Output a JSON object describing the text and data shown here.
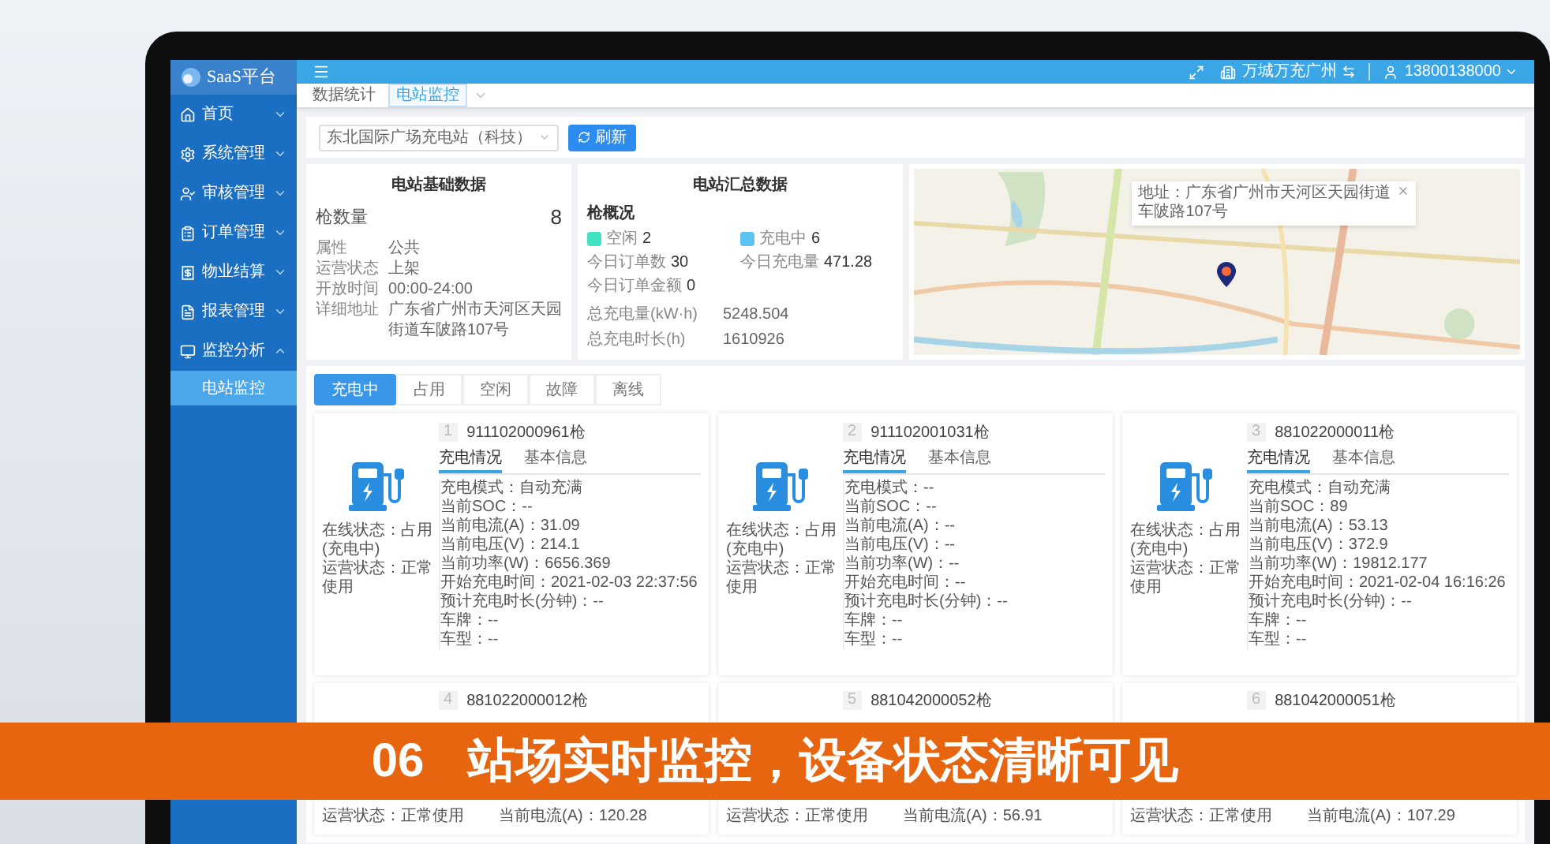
{
  "sidebar": {
    "logo": "SaaS平台",
    "items": [
      {
        "label": "首页",
        "expanded": false
      },
      {
        "label": "系统管理",
        "expanded": false
      },
      {
        "label": "审核管理",
        "expanded": false
      },
      {
        "label": "订单管理",
        "expanded": false
      },
      {
        "label": "物业结算",
        "expanded": false
      },
      {
        "label": "报表管理",
        "expanded": false
      },
      {
        "label": "监控分析",
        "expanded": true,
        "children": [
          {
            "label": "电站监控",
            "selected": true
          }
        ]
      }
    ]
  },
  "header": {
    "account": "万城万充广州",
    "user": "13800138000"
  },
  "breadcrumb": [
    {
      "label": "数据统计",
      "selected": false
    },
    {
      "label": "电站监控",
      "selected": true
    }
  ],
  "filter": {
    "station": "东北国际广场充电站（科技）",
    "button": "刷新"
  },
  "station_basic": {
    "title": "电站基础数据",
    "count_label": "枪数量",
    "count": "8",
    "rows": [
      {
        "label": "属性",
        "value": "公共"
      },
      {
        "label": "运营状态",
        "value": "上架"
      },
      {
        "label": "开放时间",
        "value": "00:00-24:00"
      },
      {
        "label": "详细地址",
        "value": "广东省广州市天河区天园街道车陂路107号"
      }
    ]
  },
  "station_summary": {
    "title": "电站汇总数据",
    "section": "枪概况",
    "statuses": [
      {
        "label": "空闲",
        "count": "2",
        "color": "#3fe3c3"
      },
      {
        "label": "充电中",
        "count": "6",
        "color": "#5cc3f2"
      }
    ],
    "today": [
      {
        "label": "今日订单数",
        "value": "30"
      },
      {
        "label": "今日充电量",
        "value": "471.28"
      },
      {
        "label": "今日订单金额",
        "value": "0"
      }
    ],
    "totals": [
      {
        "label": "总充电量(kW·h)",
        "value": "5248.504"
      },
      {
        "label": "总充电时长(h)",
        "value": "1610926"
      }
    ]
  },
  "map": {
    "popup": "地址：广东省广州市天河区天园街道车陂路107号"
  },
  "tabs": [
    {
      "label": "充电中",
      "selected": true
    },
    {
      "label": "占用",
      "selected": false
    },
    {
      "label": "空闲",
      "selected": false
    },
    {
      "label": "故障",
      "selected": false
    },
    {
      "label": "离线",
      "selected": false
    }
  ],
  "cards": [
    {
      "number": "1",
      "gun": "911102000961枪",
      "online": "在线状态：占用(充电中)",
      "operation": "运营状态：正常使用",
      "subtabs": [
        {
          "label": "充电情况",
          "selected": true
        },
        {
          "label": "基本信息",
          "selected": false
        }
      ],
      "fields": [
        "充电模式：自动充满",
        "当前SOC：--",
        "当前电流(A)：31.09",
        "当前电压(V)：214.1",
        "当前功率(W)：6656.369",
        "开始充电时间：2021-02-03 22:37:56",
        "预计充电时长(分钟)：--",
        "车牌：--",
        "车型：--"
      ]
    },
    {
      "number": "2",
      "gun": "911102001031枪",
      "online": "在线状态：占用(充电中)",
      "operation": "运营状态：正常使用",
      "subtabs": [
        {
          "label": "充电情况",
          "selected": true
        },
        {
          "label": "基本信息",
          "selected": false
        }
      ],
      "fields": [
        "充电模式：--",
        "当前SOC：--",
        "当前电流(A)：--",
        "当前电压(V)：--",
        "当前功率(W)：--",
        "开始充电时间：--",
        "预计充电时长(分钟)：--",
        "车牌：--",
        "车型：--"
      ]
    },
    {
      "number": "3",
      "gun": "881022000011枪",
      "online": "在线状态：占用(充电中)",
      "operation": "运营状态：正常使用",
      "subtabs": [
        {
          "label": "充电情况",
          "selected": true
        },
        {
          "label": "基本信息",
          "selected": false
        }
      ],
      "fields": [
        "充电模式：自动充满",
        "当前SOC：89",
        "当前电流(A)：53.13",
        "当前电压(V)：372.9",
        "当前功率(W)：19812.177",
        "开始充电时间：2021-02-04 16:16:26",
        "预计充电时长(分钟)：--",
        "车牌：--",
        "车型：--"
      ]
    }
  ],
  "cards_partial": [
    {
      "number": "4",
      "gun": "881022000012枪",
      "operation": "运营状态：正常使用",
      "field": "当前电流(A)：120.28"
    },
    {
      "number": "5",
      "gun": "881042000052枪",
      "operation": "运营状态：正常使用",
      "field": "当前电流(A)：56.91"
    },
    {
      "number": "6",
      "gun": "881042000051枪",
      "operation": "运营状态：正常使用",
      "field": "当前电流(A)：107.29"
    }
  ],
  "banner": {
    "number": "06",
    "title": "站场实时监控，设备状态清晰可见"
  }
}
